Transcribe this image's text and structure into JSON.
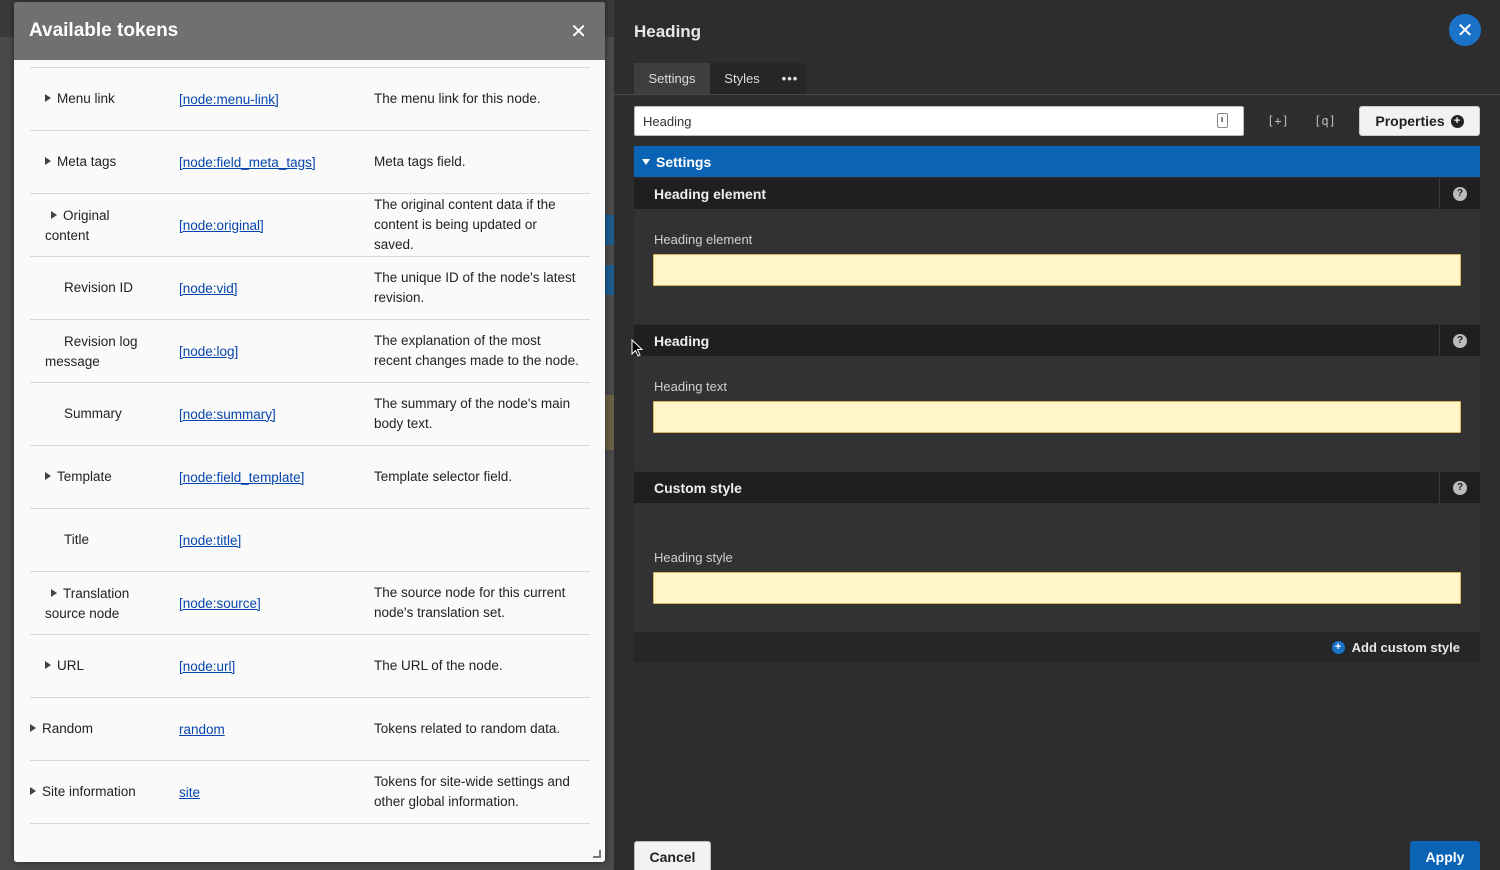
{
  "tokens_dialog": {
    "title": "Available tokens",
    "close_symbol": "✕",
    "rows": [
      {
        "name": "Menu link",
        "expandable": true,
        "level": 1,
        "token": "[node:menu-link]",
        "description": "The menu link for this node."
      },
      {
        "name": "Meta tags",
        "expandable": true,
        "level": 1,
        "token": "[node:field_meta_tags]",
        "description": "Meta tags field."
      },
      {
        "name_line1": "Original",
        "name_line2": "content",
        "expandable": true,
        "level": 1,
        "token": "[node:original]",
        "description": "The original content data if the content is being updated or saved."
      },
      {
        "name": "Revision ID",
        "expandable": false,
        "level": 1,
        "token": "[node:vid]",
        "description": "The unique ID of the node's latest revision."
      },
      {
        "name_line1": "Revision log",
        "name_line2": "message",
        "expandable": false,
        "level": 1,
        "token": "[node:log]",
        "description": "The explanation of the most recent changes made to the node."
      },
      {
        "name": "Summary",
        "expandable": false,
        "level": 1,
        "token": "[node:summary]",
        "description": "The summary of the node's main body text."
      },
      {
        "name": "Template",
        "expandable": true,
        "level": 1,
        "token": "[node:field_template]",
        "description": "Template selector field."
      },
      {
        "name": "Title",
        "expandable": false,
        "level": 1,
        "token": "[node:title]",
        "description": ""
      },
      {
        "name_line1": "Translation",
        "name_line2": "source node",
        "expandable": true,
        "level": 1,
        "token": "[node:source]",
        "description": "The source node for this current node's translation set."
      },
      {
        "name": "URL",
        "expandable": true,
        "level": 1,
        "token": "[node:url]",
        "description": "The URL of the node."
      },
      {
        "name": "Random",
        "expandable": true,
        "level": 0,
        "token": "random",
        "description": "Tokens related to random data."
      },
      {
        "name": "Site information",
        "expandable": true,
        "level": 0,
        "token": "site",
        "description": "Tokens for site-wide settings and other global information."
      }
    ]
  },
  "editor": {
    "title": "Heading",
    "close_symbol": "✕",
    "tabs": [
      {
        "label": "Settings"
      },
      {
        "label": "Styles"
      },
      {
        "label": "•••"
      }
    ],
    "name_input_value": "Heading",
    "expand_icon_glyph": "[+]",
    "search_icon_glyph": "[q]",
    "properties_label": "Properties",
    "settings_label": "Settings",
    "sections": [
      {
        "title": "Heading element",
        "field_label": "Heading element",
        "value": ""
      },
      {
        "title": "Heading",
        "field_label": "Heading text",
        "value": ""
      },
      {
        "title": "Custom style",
        "field_label": "Heading style",
        "value": ""
      }
    ],
    "add_custom_style_label": "Add custom style",
    "cancel_label": "Cancel",
    "apply_label": "Apply"
  },
  "colors": {
    "accent_blue": "#0b63b6",
    "field_background": "#fff5c8",
    "panel_dark": "#2d2d2f"
  }
}
